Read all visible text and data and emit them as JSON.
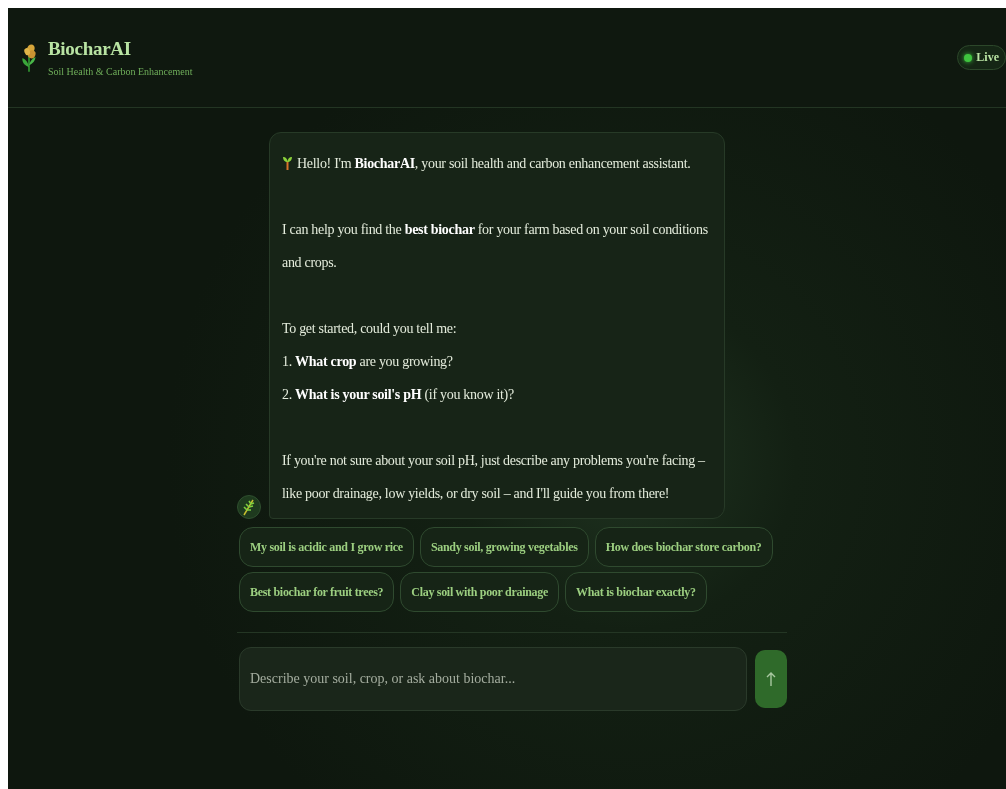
{
  "header": {
    "title": "BiocharAI",
    "subtitle": "Soil Health & Carbon Enhancement",
    "status": {
      "label": "Live",
      "on": true
    }
  },
  "message": {
    "greeting": "Hello! I'm **BiocharAI**, your soil health and carbon enhancement assistant.",
    "paragraphs": [
      "I can help you find the **best biochar** for your farm based on your soil conditions and crops."
    ],
    "question_intro": "To get started, could you tell me:",
    "questions": [
      "1. **What crop** are you growing?",
      "2. **What is your soil's pH** (if you know it)?"
    ],
    "closing": "If you're not sure about your soil pH, just describe any problems you're facing – like poor drainage, low yields, or dry soil – and I'll guide you from there!"
  },
  "suggestions": [
    [
      "My soil is acidic and I grow rice",
      "Sandy soil, growing vegetables",
      "How does biochar store carbon?"
    ],
    [
      "Best biochar for fruit trees?",
      "Clay soil with poor drainage",
      "What is biochar exactly?"
    ]
  ],
  "composer": {
    "placeholder": "Describe your soil, crop, or ask about biochar..."
  }
}
